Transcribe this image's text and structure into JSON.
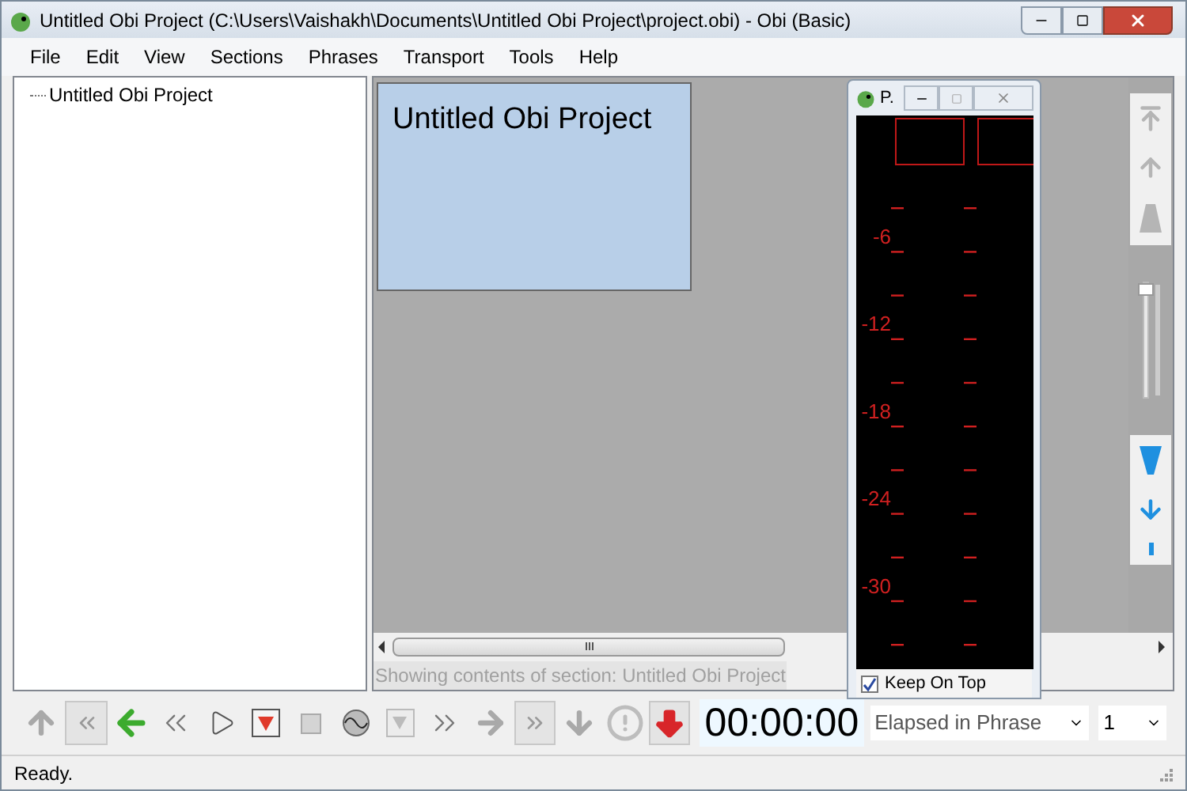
{
  "window": {
    "title": "Untitled Obi Project (C:\\Users\\Vaishakh\\Documents\\Untitled Obi Project\\project.obi) - Obi (Basic)"
  },
  "menu": [
    "File",
    "Edit",
    "View",
    "Sections",
    "Phrases",
    "Transport",
    "Tools",
    "Help"
  ],
  "tree": [
    {
      "label": "Untitled Obi Project"
    }
  ],
  "section_block": {
    "title": "Untitled Obi Project"
  },
  "content_status": "Showing contents of section:  Untitled Obi Project",
  "peak_meter": {
    "title": "P.",
    "scale": [
      "-6",
      "-12",
      "-18",
      "-24",
      "-30"
    ],
    "keep_on_top": {
      "label": "Keep On Top",
      "checked": true
    }
  },
  "zoom_slider": {
    "level": 1
  },
  "time_display": "00:00:00",
  "time_mode": "Elapsed in Phrase",
  "level_select": "1",
  "status_bar": "Ready."
}
